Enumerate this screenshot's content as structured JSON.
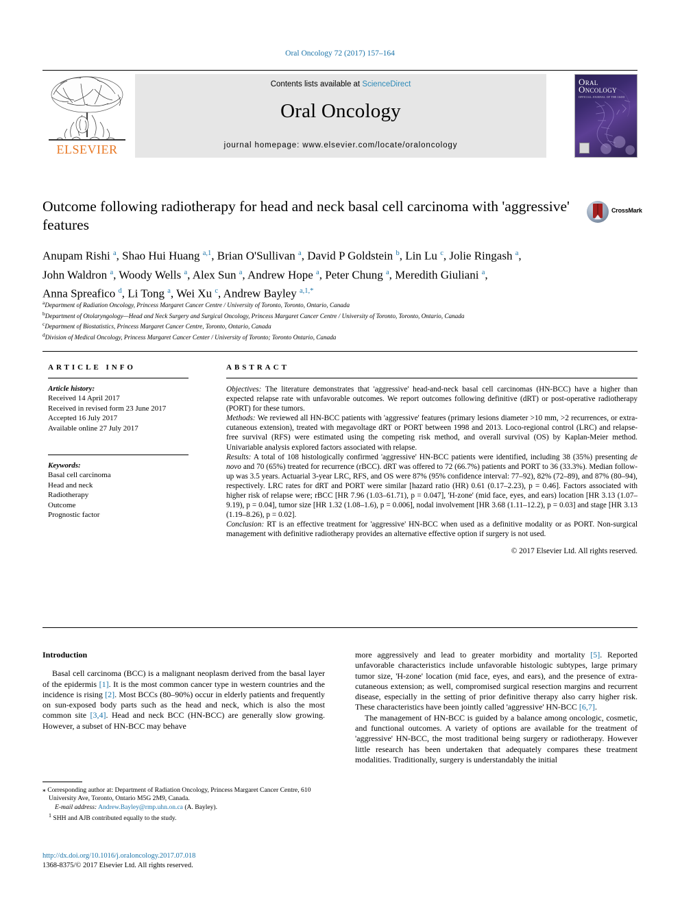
{
  "running_head": "Oral Oncology 72 (2017) 157–164",
  "masthead": {
    "contents_prefix": "Contents lists available at ",
    "sciencedirect": "ScienceDirect",
    "journal_name": "Oral Oncology",
    "homepage": "journal homepage: www.elsevier.com/locate/oraloncology",
    "publisher": "ELSEVIER",
    "cover_title_line1": "RAL",
    "cover_title_line2": "NCOLOGY",
    "cover_subtitle": "OFFICIAL JOURNAL OF THE IAOO",
    "accent_blue": "#1b73a8",
    "elsevier_orange": "#e87722",
    "band_gray": "#e6e6e6"
  },
  "article": {
    "title": "Outcome following radiotherapy for head and neck basal cell carcinoma with 'aggressive' features",
    "crossmark_label": "CrossMark",
    "authors_line1": "Anupam Rishi a, Shao Hui Huang a,1, Brian O'Sullivan a, David P Goldstein b, Lin Lu c, Jolie Ringash a,",
    "authors_line2": "John Waldron a, Woody Wells a, Alex Sun a, Andrew Hope a, Peter Chung a, Meredith Giuliani a,",
    "authors_line3": "Anna Spreafico d, Li Tong a, Wei Xu c, Andrew Bayley a,1,*",
    "affiliations": [
      {
        "mark": "a",
        "text": "Department of Radiation Oncology, Princess Margaret Cancer Centre / University of Toronto, Toronto, Ontario, Canada"
      },
      {
        "mark": "b",
        "text": "Department of Otolaryngology—Head and Neck Surgery and Surgical Oncology, Princess Margaret Cancer Centre / University of Toronto, Toronto, Ontario, Canada"
      },
      {
        "mark": "c",
        "text": "Department of Biostatistics, Princess Margaret Cancer Centre, Toronto, Ontario, Canada"
      },
      {
        "mark": "d",
        "text": "Division of Medical Oncology, Princess Margaret Cancer Center / University of Toronto; Toronto Ontario, Canada"
      }
    ]
  },
  "article_info": {
    "heading": "ARTICLE INFO",
    "history_label": "Article history:",
    "history": [
      "Received 14 April 2017",
      "Received in revised form 23 June 2017",
      "Accepted 16 July 2017",
      "Available online 27 July 2017"
    ],
    "keywords_label": "Keywords:",
    "keywords": [
      "Basal cell carcinoma",
      "Head and neck",
      "Radiotherapy",
      "Outcome",
      "Prognostic factor"
    ]
  },
  "abstract": {
    "heading": "ABSTRACT",
    "objectives_label": "Objectives:",
    "objectives_text": " The literature demonstrates that 'aggressive' head-and-neck basal cell carcinomas (HN-BCC) have a higher than expected relapse rate with unfavorable outcomes. We report outcomes following definitive (dRT) or post-operative radiotherapy (PORT) for these tumors.",
    "methods_label": "Methods:",
    "methods_text": " We reviewed all HN-BCC patients with 'aggressive' features (primary lesions diameter >10 mm, >2 recurrences, or extra-cutaneous extension), treated with megavoltage dRT or PORT between 1998 and 2013. Loco-regional control (LRC) and relapse-free survival (RFS) were estimated using the competing risk method, and overall survival (OS) by Kaplan-Meier method. Univariable analysis explored factors associated with relapse.",
    "results_label": "Results:",
    "results_text_a": " A total of 108 histologically confirmed 'aggressive' HN-BCC patients were identified, including 38 (35%) presenting ",
    "results_de_novo": "de novo",
    "results_text_b": " and 70 (65%) treated for recurrence (rBCC). dRT was offered to 72 (66.7%) patients and PORT to 36 (33.3%). Median follow-up was 3.5 years. Actuarial 3-year LRC, RFS, and OS were 87% (95% confidence interval: 77–92), 82% (72–89), and 87% (80–94), respectively. LRC rates for dRT and PORT were similar [hazard ratio (HR) 0.61 (0.17–2.23), p = 0.46]. Factors associated with higher risk of relapse were; rBCC [HR 7.96 (1.03–61.71), p = 0.047], 'H-zone' (mid face, eyes, and ears) location [HR 3.13 (1.07–9.19), p = 0.04], tumor size [HR 1.32 (1.08–1.6), p = 0.006], nodal involvement [HR 3.68 (1.11–12.2), p = 0.03] and stage [HR 3.13 (1.19–8.26), p = 0.02].",
    "conclusion_label": "Conclusion:",
    "conclusion_text": " RT is an effective treatment for 'aggressive' HN-BCC when used as a definitive modality or as PORT. Non-surgical management with definitive radiotherapy provides an alternative effective option if surgery is not used.",
    "copyright": "© 2017 Elsevier Ltd. All rights reserved."
  },
  "introduction": {
    "heading": "Introduction",
    "left_p1_a": "Basal cell carcinoma (BCC) is a malignant neoplasm derived from the basal layer of the epidermis ",
    "left_ref1": "[1]",
    "left_p1_b": ". It is the most common cancer type in western countries and the incidence is rising ",
    "left_ref2": "[2]",
    "left_p1_c": ". Most BCCs (80–90%) occur in elderly patients and frequently on sun-exposed body parts such as the head and neck, which is also the most common site ",
    "left_ref34": "[3,4]",
    "left_p1_d": ". Head and neck BCC (HN-BCC) are generally slow growing. However, a subset of HN-BCC may behave",
    "right_p1_a": "more aggressively and lead to greater morbidity and mortality ",
    "right_ref5": "[5]",
    "right_p1_b": ". Reported unfavorable characteristics include unfavorable histologic subtypes, large primary tumor size, 'H-zone' location (mid face, eyes, and ears), and the presence of extra-cutaneous extension; as well, compromised surgical resection margins and recurrent disease, especially in the setting of prior definitive therapy also carry higher risk. These characteristics have been jointly called 'aggressive' HN-BCC ",
    "right_ref67": "[6,7]",
    "right_p1_c": ".",
    "right_p2": "The management of HN-BCC is guided by a balance among oncologic, cosmetic, and functional outcomes. A variety of options are available for the treatment of 'aggressive' HN-BCC, the most traditional being surgery or radiotherapy. However little research has been undertaken that adequately compares these treatment modalities. Traditionally, surgery is understandably the initial"
  },
  "footnotes": {
    "star_marker": "⁎",
    "corresponding": " Corresponding author at: Department of Radiation Oncology, Princess Margaret Cancer Centre, 610 University Ave, Toronto, Ontario M5G 2M9, Canada.",
    "email_label": "E-mail address:",
    "email": "Andrew.Bayley@rmp.uhn.on.ca",
    "email_suffix": " (A. Bayley).",
    "note_marker": "1",
    "note_text": " SHH and AJB contributed equally to the study.",
    "doi": "http://dx.doi.org/10.1016/j.oraloncology.2017.07.018",
    "issn_line": "1368-8375/© 2017 Elsevier Ltd. All rights reserved."
  }
}
